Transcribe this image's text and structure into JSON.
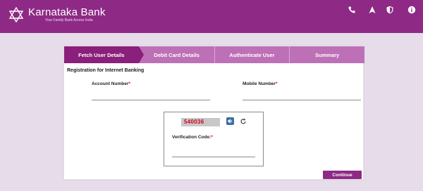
{
  "header": {
    "brand_name": "Karnataka Bank",
    "tagline": "Your Family Bank Across India",
    "icons": [
      "phone-icon",
      "location-arrow-icon",
      "shield-icon",
      "info-icon"
    ],
    "color": "#8e2a86"
  },
  "stepper": {
    "steps": [
      {
        "label": "Fetch User Details",
        "active": true
      },
      {
        "label": "Debit Card Details",
        "active": false
      },
      {
        "label": "Authenticate User",
        "active": false
      },
      {
        "label": "Summary",
        "active": false
      }
    ],
    "active_color": "#8a1f7c",
    "inactive_color": "#be70b7"
  },
  "form": {
    "section_title": "Registration for Internet Banking",
    "account_number": {
      "label": "Account Number",
      "required_mark": "*",
      "value": ""
    },
    "mobile_number": {
      "label": "Mobile Number",
      "required_mark": "*",
      "value": ""
    },
    "captcha": {
      "code": "540036",
      "verification_label": "Verification Code:",
      "required_mark": "*",
      "value": ""
    },
    "continue_label": "Continue"
  }
}
